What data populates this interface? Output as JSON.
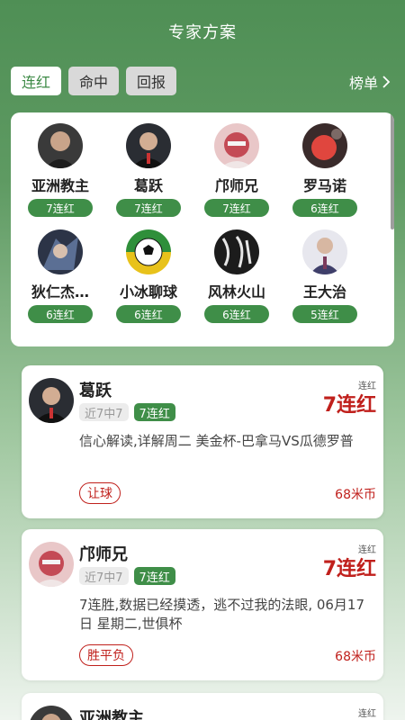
{
  "header": {
    "title": "专家方案"
  },
  "tabs": [
    {
      "label": "连红",
      "active": true
    },
    {
      "label": "命中",
      "active": false
    },
    {
      "label": "回报",
      "active": false
    }
  ],
  "ranking_label": "榜单",
  "experts": [
    {
      "name": "亚洲教主",
      "streak": "7连红"
    },
    {
      "name": "葛跃",
      "streak": "7连红"
    },
    {
      "name": "邝师兄",
      "streak": "7连红"
    },
    {
      "name": "罗马诺",
      "streak": "6连红"
    },
    {
      "name": "狄仁杰…",
      "streak": "6连红"
    },
    {
      "name": "小冰聊球",
      "streak": "6连红"
    },
    {
      "name": "风林火山",
      "streak": "6连红"
    },
    {
      "name": "王大治",
      "streak": "5连红"
    }
  ],
  "plans": [
    {
      "name": "葛跃",
      "tag_recent": "近7中7",
      "tag_streak": "7连红",
      "streak_label": "连红",
      "streak": "7连红",
      "description": "信心解读,详解周二 美金杯-巴拿马VS瓜德罗普",
      "market": "让球",
      "price": "68米币"
    },
    {
      "name": "邝师兄",
      "tag_recent": "近7中7",
      "tag_streak": "7连红",
      "streak_label": "连红",
      "streak": "7连红",
      "description": "7连胜,数据已经摸透，逃不过我的法眼, 06月17日 星期二,世俱杯",
      "market": "胜平负",
      "price": "68米币"
    },
    {
      "name": "亚洲教主",
      "streak_label": "连红"
    }
  ],
  "colors": {
    "brand_green": "#3f8e48",
    "accent_red": "#c0201c"
  }
}
